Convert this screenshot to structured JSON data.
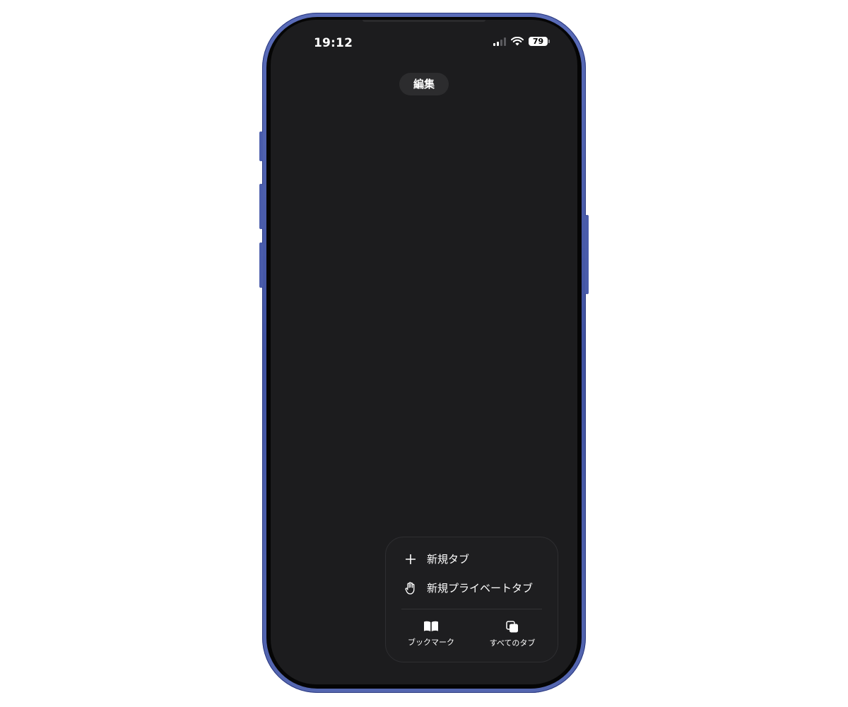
{
  "status_bar": {
    "time": "19:12",
    "battery": "79"
  },
  "header": {
    "edit_label": "編集"
  },
  "menu": {
    "items": [
      {
        "label": "新規タブ",
        "icon": "plus-icon"
      },
      {
        "label": "新規プライベートタブ",
        "icon": "hand-icon"
      }
    ],
    "bottom": [
      {
        "label": "ブックマーク",
        "icon": "book-icon"
      },
      {
        "label": "すべてのタブ",
        "icon": "tabs-icon"
      }
    ]
  },
  "colors": {
    "frame": "#4a5cab",
    "screen": "#1c1c1e",
    "menu_bg": "#1e1e20",
    "pill_bg": "#2c2c2e"
  }
}
